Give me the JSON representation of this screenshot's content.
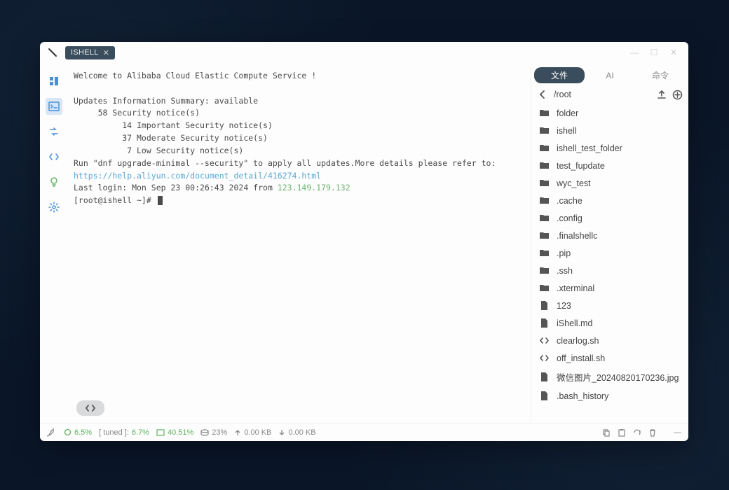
{
  "tab": {
    "label": "ISHELL"
  },
  "terminal": {
    "welcome": "Welcome to Alibaba Cloud Elastic Compute Service !",
    "updates_header": "Updates Information Summary: available",
    "sec_line": "     58 Security notice(s)",
    "imp_line": "          14 Important Security notice(s)",
    "mod_line": "          37 Moderate Security notice(s)",
    "low_line": "           7 Low Security notice(s)",
    "run_line": "Run \"dnf upgrade-minimal --security\" to apply all updates.More details please refer to:",
    "help_url": "https://help.aliyun.com/document_detail/416274.html",
    "last_login_prefix": "Last login: Mon Sep 23 00:26:43 2024 from ",
    "last_login_ip": "123.149.179.132",
    "prompt": "[root@ishell ~]# "
  },
  "right": {
    "tabs": {
      "files": "文件",
      "ai": "AI",
      "cmd": "命令"
    },
    "path": "/root",
    "items": [
      {
        "name": "folder",
        "type": "folder"
      },
      {
        "name": "ishell",
        "type": "folder"
      },
      {
        "name": "ishell_test_folder",
        "type": "folder"
      },
      {
        "name": "test_fupdate",
        "type": "folder"
      },
      {
        "name": "wyc_test",
        "type": "folder"
      },
      {
        "name": ".cache",
        "type": "folder"
      },
      {
        "name": ".config",
        "type": "folder"
      },
      {
        "name": ".finalshellc",
        "type": "folder"
      },
      {
        "name": ".pip",
        "type": "folder"
      },
      {
        "name": ".ssh",
        "type": "folder"
      },
      {
        "name": ".xterminal",
        "type": "folder"
      },
      {
        "name": "123",
        "type": "file"
      },
      {
        "name": "iShell.md",
        "type": "file"
      },
      {
        "name": "clearlog.sh",
        "type": "code"
      },
      {
        "name": "off_install.sh",
        "type": "code"
      },
      {
        "name": "微信图片_20240820170236.jpg",
        "type": "file"
      },
      {
        "name": ".bash_history",
        "type": "file"
      }
    ]
  },
  "status": {
    "cpu": "6.5%",
    "tuned_label": "[ tuned ]:",
    "tuned": "6.7%",
    "mem": "40.51%",
    "disk": "23%",
    "up": "0.00 KB",
    "down": "0.00 KB"
  }
}
